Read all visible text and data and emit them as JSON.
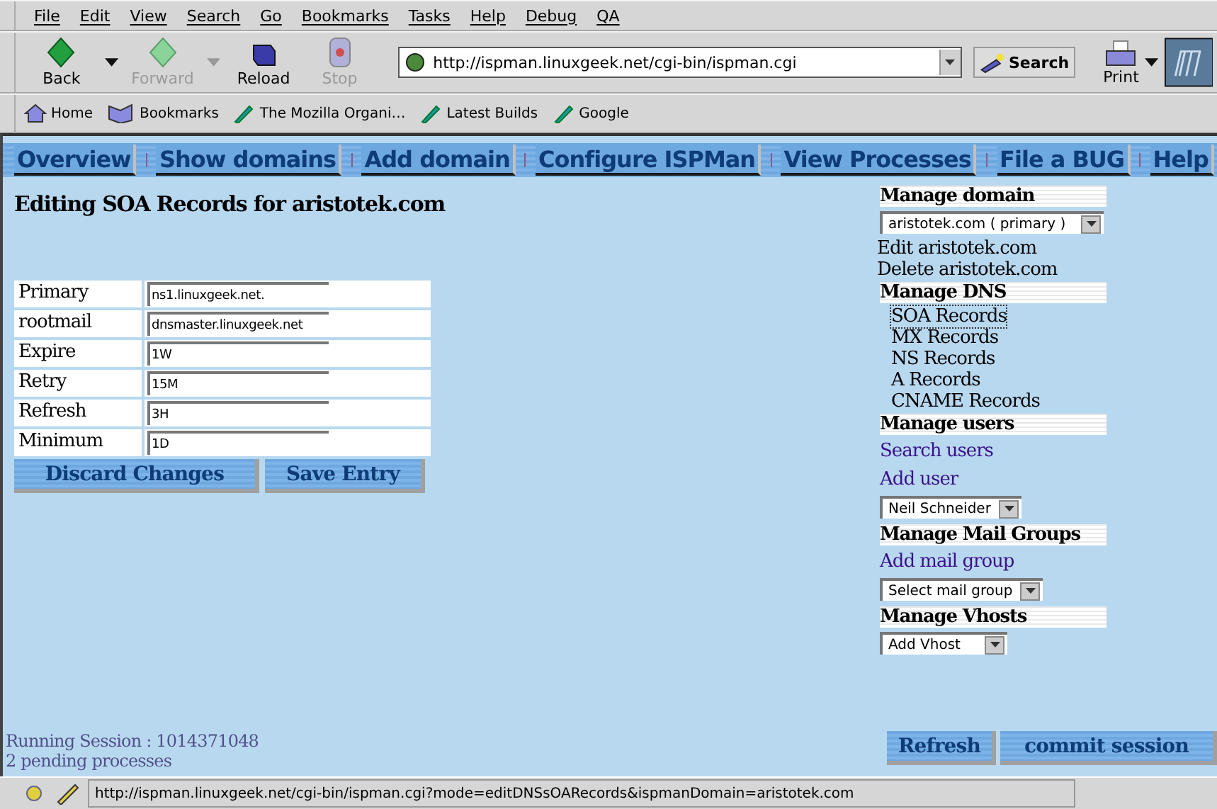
{
  "menu": [
    "File",
    "Edit",
    "View",
    "Search",
    "Go",
    "Bookmarks",
    "Tasks",
    "Help",
    "Debug",
    "QA"
  ],
  "nav_buttons": [
    {
      "label": "Back",
      "kind": "back",
      "disabled": false
    },
    {
      "label": "Forward",
      "kind": "forward",
      "disabled": true
    },
    {
      "label": "Reload",
      "kind": "reload",
      "disabled": false
    },
    {
      "label": "Stop",
      "kind": "stop",
      "disabled": true
    }
  ],
  "url": "http://ispman.linuxgeek.net/cgi-bin/ispman.cgi",
  "search_button": "Search",
  "print_button": "Print",
  "personal_toolbar": [
    {
      "label": "Home",
      "kind": "home"
    },
    {
      "label": "Bookmarks",
      "kind": "bookmarks"
    },
    {
      "label": "The Mozilla Organi…",
      "kind": "link"
    },
    {
      "label": "Latest Builds",
      "kind": "link"
    },
    {
      "label": "Google",
      "kind": "link"
    }
  ],
  "nav_tabs": [
    "Overview",
    "Show domains",
    "Add domain",
    "Configure ISPMan",
    "View Processes",
    "File a BUG",
    "Help"
  ],
  "page_title": "Editing SOA Records for aristotek.com",
  "soa_fields": [
    {
      "label": "Primary",
      "value": "ns1.linuxgeek.net."
    },
    {
      "label": "rootmail",
      "value": "dnsmaster.linuxgeek.net"
    },
    {
      "label": "Expire",
      "value": "1W"
    },
    {
      "label": "Retry",
      "value": "15M"
    },
    {
      "label": "Refresh",
      "value": "3H"
    },
    {
      "label": "Minimum",
      "value": "1D"
    }
  ],
  "form_buttons": [
    "Discard Changes",
    "Save Entry"
  ],
  "sidebar": [
    {
      "heading": "Manage domain",
      "items": [
        {
          "kind": "select",
          "text": "aristotek.com ( primary )"
        },
        {
          "kind": "action",
          "text": "Edit aristotek.com"
        },
        {
          "kind": "action",
          "text": "Delete aristotek.com"
        }
      ]
    },
    {
      "heading": "Manage DNS",
      "items": [
        {
          "kind": "record",
          "text": "SOA Records",
          "selected": true
        },
        {
          "kind": "record",
          "text": "MX Records",
          "selected": false
        },
        {
          "kind": "record",
          "text": "NS Records",
          "selected": false
        },
        {
          "kind": "record",
          "text": "A Records",
          "selected": false
        },
        {
          "kind": "record",
          "text": "CNAME Records",
          "selected": false
        }
      ]
    },
    {
      "heading": "Manage users",
      "items": [
        {
          "kind": "link",
          "text": "Search users"
        },
        {
          "kind": "link",
          "text": "Add user"
        },
        {
          "kind": "select",
          "text": "Neil Schneider"
        }
      ]
    },
    {
      "heading": "Manage Mail Groups",
      "items": [
        {
          "kind": "link",
          "text": "Add mail group"
        },
        {
          "kind": "select",
          "text": "Select mail group"
        }
      ]
    },
    {
      "heading": "Manage Vhosts",
      "items": [
        {
          "kind": "select",
          "text": "Add Vhost"
        }
      ]
    }
  ],
  "session": [
    "Running Session : 1014371048",
    "2 pending processes"
  ],
  "session_buttons": [
    "Refresh",
    "commit session"
  ],
  "status_url": "http://ispman.linuxgeek.net/cgi-bin/ispman.cgi?mode=editDNSsOARecords&ispmanDomain=aristotek.com"
}
